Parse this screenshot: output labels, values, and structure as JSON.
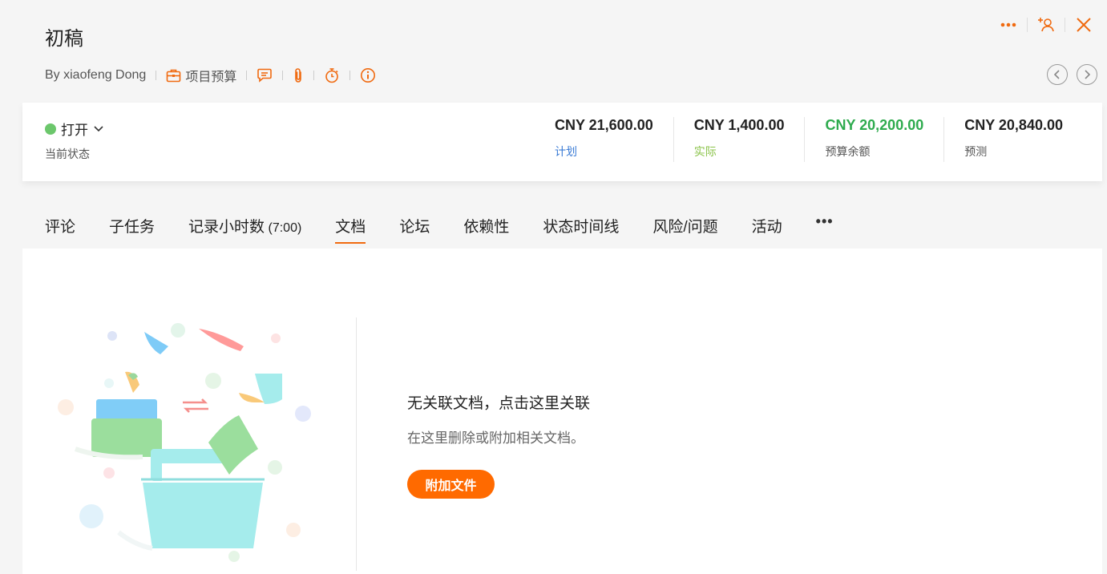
{
  "header": {
    "title": "初稿",
    "author": "By xiaofeng Dong",
    "project": "项目预算"
  },
  "status": {
    "value": "打开",
    "label": "当前状态",
    "color": "#6cc76c"
  },
  "metrics": [
    {
      "value": "CNY 21,600.00",
      "label": "计划",
      "value_color": "#222222",
      "label_color": "#3a7bd5"
    },
    {
      "value": "CNY 1,400.00",
      "label": "实际",
      "value_color": "#222222",
      "label_color": "#8bc34a"
    },
    {
      "value": "CNY 20,200.00",
      "label": "预算余额",
      "value_color": "#2eab4e",
      "label_color": "#555555"
    },
    {
      "value": "CNY 20,840.00",
      "label": "预测",
      "value_color": "#222222",
      "label_color": "#555555"
    }
  ],
  "tabs": [
    {
      "label": "评论"
    },
    {
      "label": "子任务"
    },
    {
      "label": "记录小时数",
      "suffix": " (7:00)"
    },
    {
      "label": "文档",
      "active": true
    },
    {
      "label": "论坛"
    },
    {
      "label": "依赖性"
    },
    {
      "label": "状态时间线"
    },
    {
      "label": "风险/问题"
    },
    {
      "label": "活动"
    }
  ],
  "tabs_more": "•••",
  "empty_state": {
    "title": "无关联文档，点击这里关联",
    "description": "在这里删除或附加相关文档。",
    "button": "附加文件"
  },
  "accent_color": "#f06a10"
}
